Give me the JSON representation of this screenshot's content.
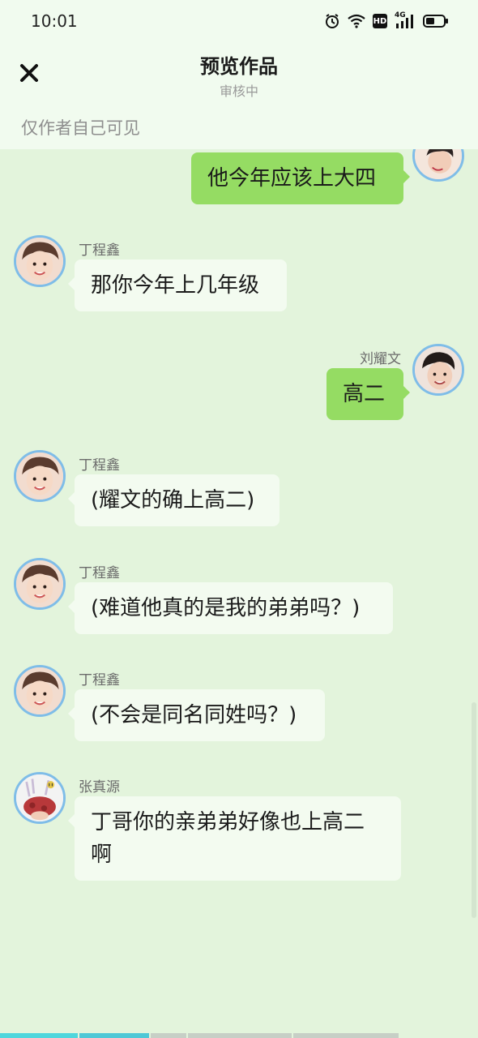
{
  "status_bar": {
    "time": "10:01",
    "icons": [
      "alarm-icon",
      "wifi-icon",
      "hd-icon",
      "signal-4g-icon",
      "battery-icon"
    ],
    "hd_label": "HD",
    "network_label": "4G"
  },
  "header": {
    "title": "预览作品",
    "subtitle": "审核中",
    "visibility_note": "仅作者自己可见"
  },
  "messages": [
    {
      "side": "right",
      "sender": "",
      "text": "他今年应该上大四"
    },
    {
      "side": "left",
      "sender": "丁程鑫",
      "text": "那你今年上几年级"
    },
    {
      "side": "right",
      "sender": "刘耀文",
      "text": "高二"
    },
    {
      "side": "left",
      "sender": "丁程鑫",
      "text": "(耀文的确上高二)"
    },
    {
      "side": "left",
      "sender": "丁程鑫",
      "text": "(难道他真的是我的弟弟吗？)"
    },
    {
      "side": "left",
      "sender": "丁程鑫",
      "text": "(不会是同名同姓吗？)"
    },
    {
      "side": "left",
      "sender": "张真源",
      "text": "丁哥你的亲弟弟好像也上高二啊"
    }
  ],
  "colors": {
    "background": "#e3f4dc",
    "header_bg": "#f1fbef",
    "bubble_right": "#95dc63",
    "bubble_left": "#f3fbf0",
    "avatar_ring": "#7fbde8",
    "progress_active": "#4fd6dc",
    "progress_inactive": "#c7cfc6"
  }
}
